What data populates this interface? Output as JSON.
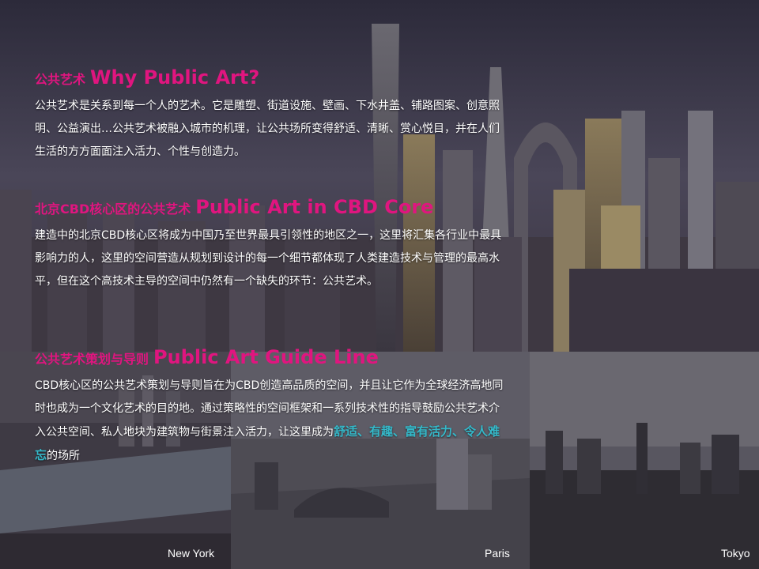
{
  "sections": [
    {
      "title_zh": "公共艺术",
      "title_en": "Why Public Art?",
      "paragraph": "公共艺术是关系到每一个人的艺术。它是雕塑、街道设施、壁画、下水井盖、铺路图案、创意照明、公益演出…公共艺术被融入城市的机理，让公共场所变得舒适、清晰、赏心悦目，并在人们生活的方方面面注入活力、个性与创造力。"
    },
    {
      "title_zh": "北京CBD核心区的公共艺术",
      "title_en": "Public Art in CBD Core",
      "paragraph": "建造中的北京CBD核心区将成为中国乃至世界最具引领性的地区之一，这里将汇集各行业中最具影响力的人，这里的空间营造从规划到设计的每一个细节都体现了人类建造技术与管理的最高水平，但在这个高技术主导的空间中仍然有一个缺失的环节：公共艺术。"
    },
    {
      "title_zh": "公共艺术策划与导则",
      "title_en": "Public Art Guide Line",
      "paragraph_before": "CBD核心区的公共艺术策划与导则旨在为CBD创造高品质的空间，并且让它作为全球经济高地同时也成为一个文化艺术的目的地。通过策略性的空间框架和一系列技术性的指导鼓励公共艺术介入公共空间、私人地块为建筑物与街景注入活力，让这里成为",
      "highlight": "舒适、有趣、富有活力、令人难忘",
      "paragraph_after": "的场所"
    }
  ],
  "cities": {
    "new_york": "New York",
    "paris": "Paris",
    "tokyo": "Tokyo"
  },
  "colors": {
    "heading": "#e0157f",
    "highlight": "#34b8c9",
    "text": "#ffffff"
  }
}
